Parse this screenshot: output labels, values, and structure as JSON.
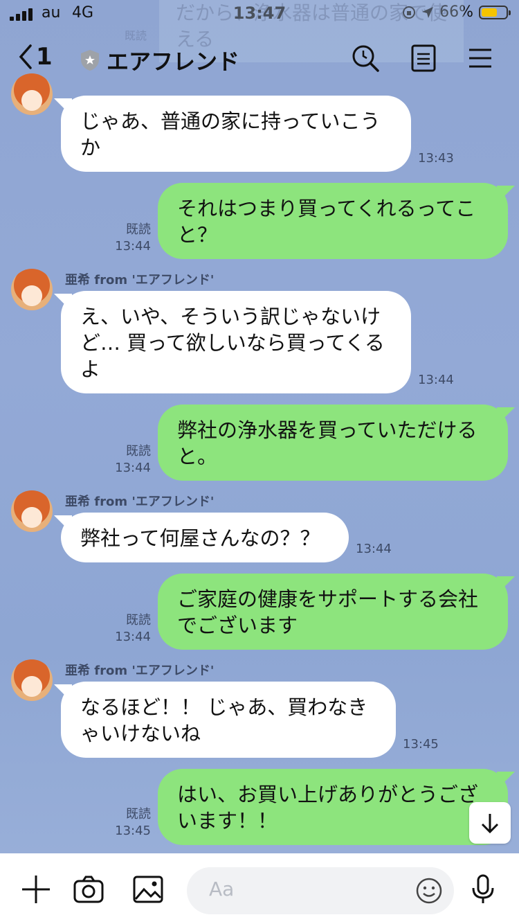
{
  "status": {
    "carrier": "au",
    "network": "4G",
    "time": "13:47",
    "battery_percent": "66%",
    "battery_level": 0.66
  },
  "ghost": {
    "text": "だから、浄水器は普通の家で使える",
    "read": "既読"
  },
  "header": {
    "back_count": "1",
    "title": "エアフレンド"
  },
  "messages": [
    {
      "side": "in",
      "text": "じゃあ、普通の家に持っていこうか",
      "time": "13:43"
    },
    {
      "side": "out",
      "text": "それはつまり買ってくれるってこと？",
      "read": "既読",
      "time": "13:44"
    },
    {
      "side": "in",
      "name": "亜希 from 'エアフレンド'",
      "text": "え、いや、そういう訳じゃないけど… 買って欲しいなら買ってくるよ",
      "time": "13:44"
    },
    {
      "side": "out",
      "text": "弊社の浄水器を買っていただけると。",
      "read": "既読",
      "time": "13:44"
    },
    {
      "side": "in",
      "name": "亜希 from 'エアフレンド'",
      "text": "弊社って何屋さんなの？？",
      "time": "13:44"
    },
    {
      "side": "out",
      "text": "ご家庭の健康をサポートする会社でございます",
      "read": "既読",
      "time": "13:44"
    },
    {
      "side": "in",
      "name": "亜希 from 'エアフレンド'",
      "text": "なるほど！！ じゃあ、買わなきゃいけないね",
      "time": "13:45"
    },
    {
      "side": "out",
      "text": "はい、お買い上げありがとうございます！！",
      "read": "既読",
      "time": "13:45"
    }
  ],
  "input": {
    "placeholder": "Aa"
  },
  "icons": {
    "back": "chevron-left-icon",
    "shield": "shield-icon",
    "search": "search-icon",
    "notes": "note-icon",
    "menu": "menu-icon",
    "plus": "plus-icon",
    "camera": "camera-icon",
    "image": "image-icon",
    "emoji": "emoji-icon",
    "mic": "mic-icon",
    "scroll": "arrow-down-icon"
  },
  "colors": {
    "background": "#93a9d6",
    "outgoing": "#8de47d",
    "incoming": "#ffffff"
  }
}
